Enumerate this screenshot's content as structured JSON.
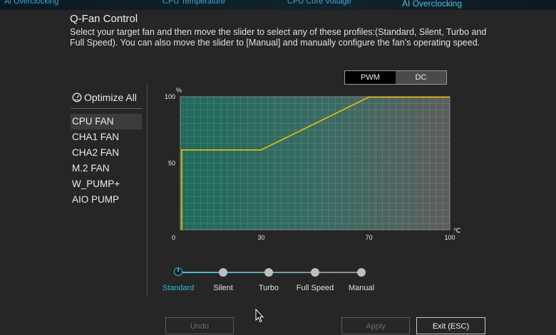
{
  "top_strip": {
    "tabs": [
      "Ai Overclocking",
      "CPU Temperature",
      "CPU Core Voltage",
      "AI Overclocking"
    ]
  },
  "header": {
    "title": "Q-Fan Control",
    "description": "Select your target fan and then move the slider to select any of these profiles:(Standard, Silent, Turbo and Full Speed). You can also move the slider to [Manual] and manually configure the fan’s operating speed."
  },
  "mode_toggle": {
    "options": [
      "PWM",
      "DC"
    ],
    "selected": "PWM"
  },
  "sidebar": {
    "optimize_all_label": "Optimize All",
    "fans": [
      "CPU FAN",
      "CHA1 FAN",
      "CHA2 FAN",
      "M.2 FAN",
      "W_PUMP+",
      "AIO PUMP"
    ],
    "selected_fan": "CPU FAN"
  },
  "chart_data": {
    "type": "line",
    "x_unit": "℃",
    "y_unit": "%",
    "xlim": [
      0,
      100
    ],
    "ylim": [
      0,
      100
    ],
    "x_ticks": [
      0,
      30,
      70,
      100
    ],
    "y_ticks": [
      50,
      100
    ],
    "grid": true,
    "series": [
      {
        "x": [
          0,
          0,
          30,
          70,
          100
        ],
        "y": [
          0,
          60,
          60,
          100,
          100
        ]
      }
    ],
    "line_color": "#f0c000"
  },
  "profile_slider": {
    "options": [
      "Standard",
      "Silent",
      "Turbo",
      "Full Speed",
      "Manual"
    ],
    "selected": "Standard"
  },
  "buttons": {
    "undo": "Undo",
    "apply": "Apply",
    "exit": "Exit (ESC)"
  },
  "colors": {
    "accent": "#22b7e6",
    "curve": "#f0c000",
    "plot_left": "#1f6a5c",
    "plot_right": "#5e5e5e"
  }
}
